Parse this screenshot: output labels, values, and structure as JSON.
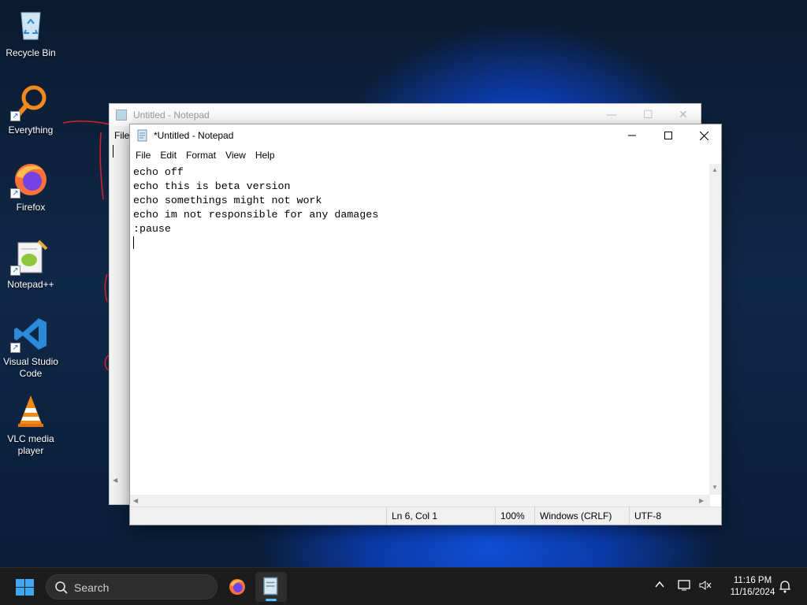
{
  "desktop": {
    "icons": [
      {
        "label": "Recycle Bin",
        "icon": "recycle-bin-icon"
      },
      {
        "label": "Everything",
        "icon": "search-magnifier-icon"
      },
      {
        "label": "Firefox",
        "icon": "firefox-icon"
      },
      {
        "label": "Notepad++",
        "icon": "notepad-plus-plus-icon"
      },
      {
        "label": "Visual Studio Code",
        "icon": "vscode-icon"
      },
      {
        "label": "VLC media player",
        "icon": "vlc-icon"
      }
    ]
  },
  "back_window": {
    "title": "Untitled - Notepad",
    "menu_first": "File"
  },
  "notepad": {
    "title": "*Untitled - Notepad",
    "menu": [
      "File",
      "Edit",
      "Format",
      "View",
      "Help"
    ],
    "lines": [
      "echo off",
      "echo this is beta version",
      "echo somethings might not work",
      "echo im not responsible for any damages",
      ":pause"
    ],
    "status": {
      "position": "Ln 6, Col 1",
      "zoom": "100%",
      "line_ending": "Windows (CRLF)",
      "encoding": "UTF-8"
    }
  },
  "taskbar": {
    "search_placeholder": "Search",
    "time": "11:16 PM",
    "date": "11/16/2024"
  },
  "colors": {
    "accent": "#3da9f5",
    "taskbar": "#1c1c1c",
    "annotation_red": "#d0202a"
  }
}
